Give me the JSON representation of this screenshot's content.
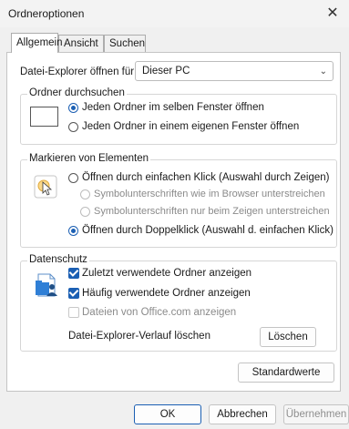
{
  "window": {
    "title": "Ordneroptionen",
    "close": "✕"
  },
  "tabs": [
    "Allgemein",
    "Ansicht",
    "Suchen"
  ],
  "explorer_open": {
    "label": "Datei-Explorer öffnen für:",
    "value": "Dieser PC"
  },
  "browse": {
    "title": "Ordner durchsuchen",
    "options": [
      "Jeden Ordner im selben Fenster öffnen",
      "Jeden Ordner in einem eigenen Fenster öffnen"
    ],
    "selected": 0
  },
  "click": {
    "title": "Markieren von Elementen",
    "single": "Öffnen durch einfachen Klick (Auswahl durch Zeigen)",
    "underline_browser": "Symbolunterschriften wie im Browser unterstreichen",
    "underline_hover": "Symbolunterschriften nur beim Zeigen unterstreichen",
    "double": "Öffnen durch Doppelklick (Auswahl d. einfachen Klick)"
  },
  "privacy": {
    "title": "Datenschutz",
    "recent_folders": "Zuletzt verwendete Ordner anzeigen",
    "frequent_folders": "Häufig verwendete Ordner anzeigen",
    "office_files": "Dateien von Office.com anzeigen",
    "clear_label": "Datei-Explorer-Verlauf löschen",
    "clear_button": "Löschen"
  },
  "buttons": {
    "defaults": "Standardwerte",
    "ok": "OK",
    "cancel": "Abbrechen",
    "apply": "Übernehmen"
  },
  "colors": {
    "accent": "#1b5fb3",
    "background": "#f0f0f0",
    "panel": "#ffffff"
  }
}
